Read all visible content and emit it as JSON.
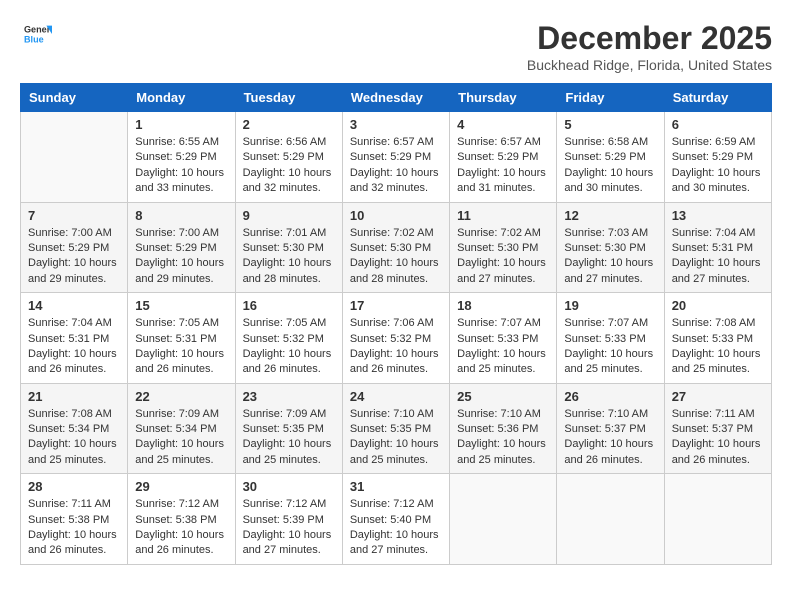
{
  "logo": {
    "general": "General",
    "blue": "Blue"
  },
  "title": "December 2025",
  "location": "Buckhead Ridge, Florida, United States",
  "days_of_week": [
    "Sunday",
    "Monday",
    "Tuesday",
    "Wednesday",
    "Thursday",
    "Friday",
    "Saturday"
  ],
  "weeks": [
    {
      "shaded": false,
      "days": [
        {
          "number": "",
          "empty": true
        },
        {
          "number": "1",
          "sunrise": "Sunrise: 6:55 AM",
          "sunset": "Sunset: 5:29 PM",
          "daylight": "Daylight: 10 hours and 33 minutes."
        },
        {
          "number": "2",
          "sunrise": "Sunrise: 6:56 AM",
          "sunset": "Sunset: 5:29 PM",
          "daylight": "Daylight: 10 hours and 32 minutes."
        },
        {
          "number": "3",
          "sunrise": "Sunrise: 6:57 AM",
          "sunset": "Sunset: 5:29 PM",
          "daylight": "Daylight: 10 hours and 32 minutes."
        },
        {
          "number": "4",
          "sunrise": "Sunrise: 6:57 AM",
          "sunset": "Sunset: 5:29 PM",
          "daylight": "Daylight: 10 hours and 31 minutes."
        },
        {
          "number": "5",
          "sunrise": "Sunrise: 6:58 AM",
          "sunset": "Sunset: 5:29 PM",
          "daylight": "Daylight: 10 hours and 30 minutes."
        },
        {
          "number": "6",
          "sunrise": "Sunrise: 6:59 AM",
          "sunset": "Sunset: 5:29 PM",
          "daylight": "Daylight: 10 hours and 30 minutes."
        }
      ]
    },
    {
      "shaded": true,
      "days": [
        {
          "number": "7",
          "sunrise": "Sunrise: 7:00 AM",
          "sunset": "Sunset: 5:29 PM",
          "daylight": "Daylight: 10 hours and 29 minutes."
        },
        {
          "number": "8",
          "sunrise": "Sunrise: 7:00 AM",
          "sunset": "Sunset: 5:29 PM",
          "daylight": "Daylight: 10 hours and 29 minutes."
        },
        {
          "number": "9",
          "sunrise": "Sunrise: 7:01 AM",
          "sunset": "Sunset: 5:30 PM",
          "daylight": "Daylight: 10 hours and 28 minutes."
        },
        {
          "number": "10",
          "sunrise": "Sunrise: 7:02 AM",
          "sunset": "Sunset: 5:30 PM",
          "daylight": "Daylight: 10 hours and 28 minutes."
        },
        {
          "number": "11",
          "sunrise": "Sunrise: 7:02 AM",
          "sunset": "Sunset: 5:30 PM",
          "daylight": "Daylight: 10 hours and 27 minutes."
        },
        {
          "number": "12",
          "sunrise": "Sunrise: 7:03 AM",
          "sunset": "Sunset: 5:30 PM",
          "daylight": "Daylight: 10 hours and 27 minutes."
        },
        {
          "number": "13",
          "sunrise": "Sunrise: 7:04 AM",
          "sunset": "Sunset: 5:31 PM",
          "daylight": "Daylight: 10 hours and 27 minutes."
        }
      ]
    },
    {
      "shaded": false,
      "days": [
        {
          "number": "14",
          "sunrise": "Sunrise: 7:04 AM",
          "sunset": "Sunset: 5:31 PM",
          "daylight": "Daylight: 10 hours and 26 minutes."
        },
        {
          "number": "15",
          "sunrise": "Sunrise: 7:05 AM",
          "sunset": "Sunset: 5:31 PM",
          "daylight": "Daylight: 10 hours and 26 minutes."
        },
        {
          "number": "16",
          "sunrise": "Sunrise: 7:05 AM",
          "sunset": "Sunset: 5:32 PM",
          "daylight": "Daylight: 10 hours and 26 minutes."
        },
        {
          "number": "17",
          "sunrise": "Sunrise: 7:06 AM",
          "sunset": "Sunset: 5:32 PM",
          "daylight": "Daylight: 10 hours and 26 minutes."
        },
        {
          "number": "18",
          "sunrise": "Sunrise: 7:07 AM",
          "sunset": "Sunset: 5:33 PM",
          "daylight": "Daylight: 10 hours and 25 minutes."
        },
        {
          "number": "19",
          "sunrise": "Sunrise: 7:07 AM",
          "sunset": "Sunset: 5:33 PM",
          "daylight": "Daylight: 10 hours and 25 minutes."
        },
        {
          "number": "20",
          "sunrise": "Sunrise: 7:08 AM",
          "sunset": "Sunset: 5:33 PM",
          "daylight": "Daylight: 10 hours and 25 minutes."
        }
      ]
    },
    {
      "shaded": true,
      "days": [
        {
          "number": "21",
          "sunrise": "Sunrise: 7:08 AM",
          "sunset": "Sunset: 5:34 PM",
          "daylight": "Daylight: 10 hours and 25 minutes."
        },
        {
          "number": "22",
          "sunrise": "Sunrise: 7:09 AM",
          "sunset": "Sunset: 5:34 PM",
          "daylight": "Daylight: 10 hours and 25 minutes."
        },
        {
          "number": "23",
          "sunrise": "Sunrise: 7:09 AM",
          "sunset": "Sunset: 5:35 PM",
          "daylight": "Daylight: 10 hours and 25 minutes."
        },
        {
          "number": "24",
          "sunrise": "Sunrise: 7:10 AM",
          "sunset": "Sunset: 5:35 PM",
          "daylight": "Daylight: 10 hours and 25 minutes."
        },
        {
          "number": "25",
          "sunrise": "Sunrise: 7:10 AM",
          "sunset": "Sunset: 5:36 PM",
          "daylight": "Daylight: 10 hours and 25 minutes."
        },
        {
          "number": "26",
          "sunrise": "Sunrise: 7:10 AM",
          "sunset": "Sunset: 5:37 PM",
          "daylight": "Daylight: 10 hours and 26 minutes."
        },
        {
          "number": "27",
          "sunrise": "Sunrise: 7:11 AM",
          "sunset": "Sunset: 5:37 PM",
          "daylight": "Daylight: 10 hours and 26 minutes."
        }
      ]
    },
    {
      "shaded": false,
      "days": [
        {
          "number": "28",
          "sunrise": "Sunrise: 7:11 AM",
          "sunset": "Sunset: 5:38 PM",
          "daylight": "Daylight: 10 hours and 26 minutes."
        },
        {
          "number": "29",
          "sunrise": "Sunrise: 7:12 AM",
          "sunset": "Sunset: 5:38 PM",
          "daylight": "Daylight: 10 hours and 26 minutes."
        },
        {
          "number": "30",
          "sunrise": "Sunrise: 7:12 AM",
          "sunset": "Sunset: 5:39 PM",
          "daylight": "Daylight: 10 hours and 27 minutes."
        },
        {
          "number": "31",
          "sunrise": "Sunrise: 7:12 AM",
          "sunset": "Sunset: 5:40 PM",
          "daylight": "Daylight: 10 hours and 27 minutes."
        },
        {
          "number": "",
          "empty": true
        },
        {
          "number": "",
          "empty": true
        },
        {
          "number": "",
          "empty": true
        }
      ]
    }
  ]
}
